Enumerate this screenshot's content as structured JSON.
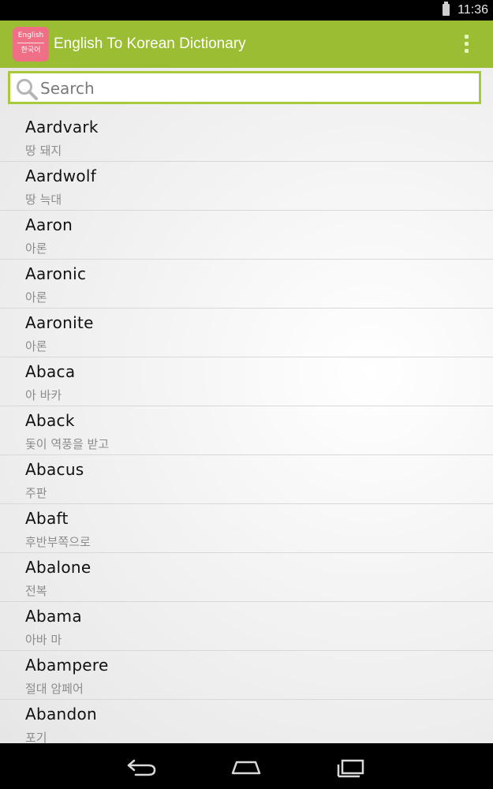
{
  "status_bar": {
    "time": "11:36",
    "battery_icon": "battery-icon"
  },
  "action_bar": {
    "app_icon": {
      "line1": "English",
      "line2": "한국어",
      "color": "#ef6f86"
    },
    "title": "English To Korean Dictionary",
    "menu_icon": "overflow-menu-icon",
    "color": "#9bbd33"
  },
  "search": {
    "placeholder": "Search",
    "value": "",
    "icon": "search-icon",
    "border_color": "#a9c93c"
  },
  "words": [
    {
      "english": "Aardvark",
      "korean": "땅 돼지"
    },
    {
      "english": "Aardwolf",
      "korean": "땅 늑대"
    },
    {
      "english": "Aaron",
      "korean": "아론"
    },
    {
      "english": "Aaronic",
      "korean": "아론"
    },
    {
      "english": "Aaronite",
      "korean": "아론"
    },
    {
      "english": "Abaca",
      "korean": "아 바카"
    },
    {
      "english": "Aback",
      "korean": "돛이 역풍을 받고"
    },
    {
      "english": "Abacus",
      "korean": "주판"
    },
    {
      "english": "Abaft",
      "korean": "후반부쪽으로"
    },
    {
      "english": "Abalone",
      "korean": "전복"
    },
    {
      "english": "Abama",
      "korean": "아바 마"
    },
    {
      "english": "Abampere",
      "korean": "절대 암페어"
    },
    {
      "english": "Abandon",
      "korean": "포기"
    }
  ],
  "nav_bar": {
    "back_icon": "back-icon",
    "home_icon": "home-icon",
    "recents_icon": "recents-icon"
  }
}
